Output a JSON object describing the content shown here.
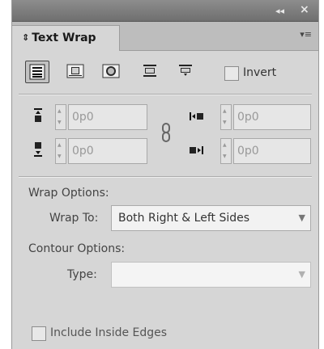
{
  "titlebar": {
    "collapse_glyph": "◂◂",
    "close_glyph": "×"
  },
  "panel": {
    "tab_label": "Text Wrap",
    "tab_chevron": "⇕",
    "menu_glyph": "▾≡"
  },
  "wrap_modes": [
    {
      "name": "no-text-wrap",
      "selected": true
    },
    {
      "name": "wrap-around-bounding-box",
      "selected": false
    },
    {
      "name": "wrap-around-object-shape",
      "selected": false
    },
    {
      "name": "jump-object",
      "selected": false
    },
    {
      "name": "jump-to-next-column",
      "selected": false
    }
  ],
  "invert": {
    "label": "Invert",
    "checked": false
  },
  "offsets": {
    "top": "0p0",
    "bottom": "0p0",
    "left": "0p0",
    "right": "0p0"
  },
  "wrap_options": {
    "section_label": "Wrap Options:",
    "wrap_to_label": "Wrap To:",
    "wrap_to_value": "Both Right & Left Sides"
  },
  "contour_options": {
    "section_label": "Contour Options:",
    "type_label": "Type:",
    "type_value": ""
  },
  "include_inside_edges": {
    "label": "Include Inside Edges",
    "checked": false
  },
  "colors": {
    "panel_bg": "#d6d6d6",
    "titlebar_bg": "#7d7d7d",
    "disabled_text": "#999999"
  }
}
